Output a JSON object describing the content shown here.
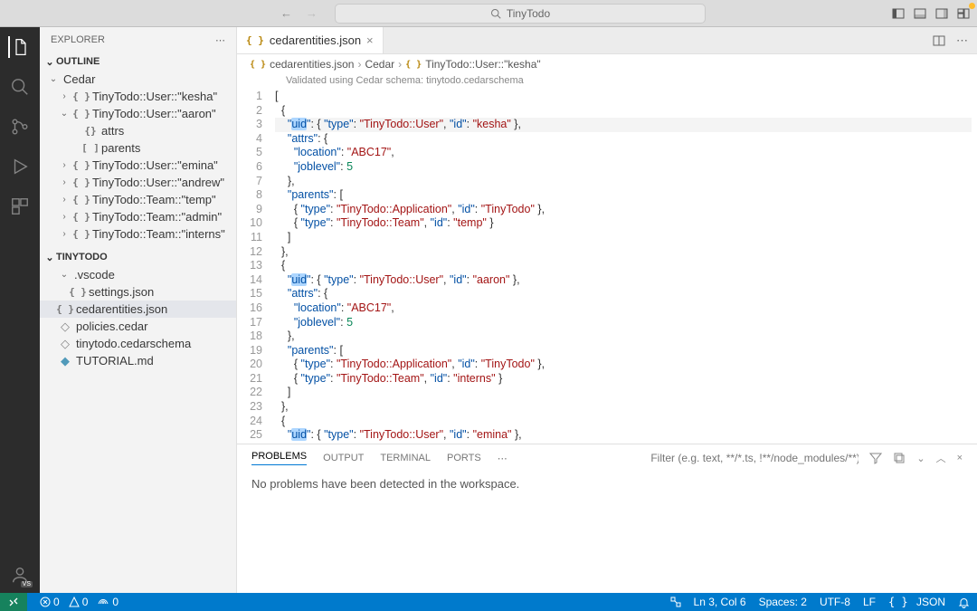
{
  "titlebar": {
    "search_label": "TinyTodo"
  },
  "sidebar": {
    "title": "EXPLORER",
    "sections": {
      "outline": {
        "label": "OUTLINE",
        "root": "Cedar",
        "items": [
          {
            "label": "TinyTodo::User::\"kesha\"",
            "chev": "›"
          },
          {
            "label": "TinyTodo::User::\"aaron\"",
            "chev": "⌄",
            "children": [
              {
                "label": "attrs",
                "icon": "{}"
              },
              {
                "label": "parents",
                "icon": "[ ]"
              }
            ]
          },
          {
            "label": "TinyTodo::User::\"emina\"",
            "chev": "›"
          },
          {
            "label": "TinyTodo::User::\"andrew\"",
            "chev": "›"
          },
          {
            "label": "TinyTodo::Team::\"temp\"",
            "chev": "›"
          },
          {
            "label": "TinyTodo::Team::\"admin\"",
            "chev": "›"
          },
          {
            "label": "TinyTodo::Team::\"interns\"",
            "chev": "›"
          }
        ]
      },
      "project": {
        "label": "TINYTODO",
        "files": [
          {
            "name": ".vscode",
            "kind": "folder"
          },
          {
            "name": "settings.json",
            "kind": "json",
            "indent": 1
          },
          {
            "name": "cedarentities.json",
            "kind": "json",
            "active": true
          },
          {
            "name": "policies.cedar",
            "kind": "cedar"
          },
          {
            "name": "tinytodo.cedarschema",
            "kind": "cedar"
          },
          {
            "name": "TUTORIAL.md",
            "kind": "md"
          }
        ]
      }
    }
  },
  "tab": {
    "filename": "cedarentities.json"
  },
  "breadcrumb": {
    "parts": [
      "cedarentities.json",
      "Cedar",
      "TinyTodo::User::\"kesha\""
    ]
  },
  "validation": "Validated using Cedar schema: tinytodo.cedarschema",
  "editor": {
    "cursor_line": 3,
    "lines": [
      "[",
      "  {",
      "    \"uid\": { \"type\": \"TinyTodo::User\", \"id\": \"kesha\" },",
      "    \"attrs\": {",
      "      \"location\": \"ABC17\",",
      "      \"joblevel\": 5",
      "    },",
      "    \"parents\": [",
      "      { \"type\": \"TinyTodo::Application\", \"id\": \"TinyTodo\" },",
      "      { \"type\": \"TinyTodo::Team\", \"id\": \"temp\" }",
      "    ]",
      "  },",
      "  {",
      "    \"uid\": { \"type\": \"TinyTodo::User\", \"id\": \"aaron\" },",
      "    \"attrs\": {",
      "      \"location\": \"ABC17\",",
      "      \"joblevel\": 5",
      "    },",
      "    \"parents\": [",
      "      { \"type\": \"TinyTodo::Application\", \"id\": \"TinyTodo\" },",
      "      { \"type\": \"TinyTodo::Team\", \"id\": \"interns\" }",
      "    ]",
      "  },",
      "  {",
      "    \"uid\": { \"type\": \"TinyTodo::User\", \"id\": \"emina\" },"
    ]
  },
  "panel": {
    "tabs": [
      "PROBLEMS",
      "OUTPUT",
      "TERMINAL",
      "PORTS"
    ],
    "active": 0,
    "filter_placeholder": "Filter (e.g. text, **/*.ts, !**/node_modules/**)",
    "body": "No problems have been detected in the workspace."
  },
  "statusbar": {
    "errors": "0",
    "warnings": "0",
    "ports": "0",
    "lncol": "Ln 3, Col 6",
    "spaces": "Spaces: 2",
    "encoding": "UTF-8",
    "eol": "LF",
    "lang": "JSON"
  }
}
